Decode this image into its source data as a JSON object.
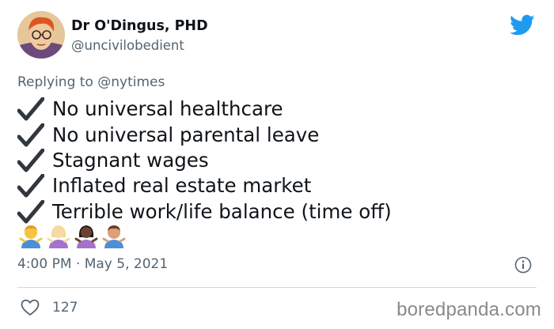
{
  "author": {
    "display_name": "Dr O'Dingus, PHD",
    "handle": "@uncivilobedient"
  },
  "reply": {
    "prefix": "Replying to ",
    "mention": "@nytimes"
  },
  "checklist": [
    {
      "icon": "check-mark-icon",
      "text": "No universal healthcare"
    },
    {
      "icon": "check-mark-icon",
      "text": "No universal parental leave"
    },
    {
      "icon": "check-mark-icon",
      "text": "Stagnant wages"
    },
    {
      "icon": "check-mark-icon",
      "text": "Inflated real estate market"
    },
    {
      "icon": "check-mark-icon",
      "text": "Terrible work/life balance (time off)"
    }
  ],
  "emojis": [
    "man-shrugging-emoji",
    "woman-shrugging-emoji",
    "woman-shrugging-dark-skin-emoji",
    "man-shrugging-medium-skin-emoji"
  ],
  "meta": {
    "time": "4:00 PM",
    "separator": " · ",
    "date": "May 5, 2021"
  },
  "engagement": {
    "likes": "127"
  },
  "watermark": "boredpanda.com",
  "colors": {
    "twitter_blue": "#1d9bf0",
    "secondary_text": "#536471",
    "primary_text": "#0f1419",
    "divider": "#cfd9de"
  }
}
